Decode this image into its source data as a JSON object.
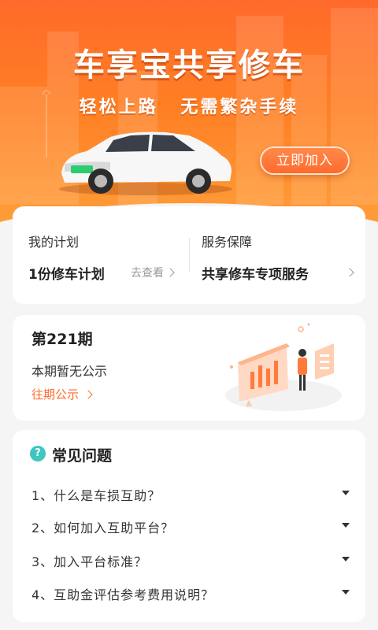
{
  "banner": {
    "headline": "车享宝共享修车",
    "subline": "轻松上路 无需繁杂手续",
    "join_button": "立即加入",
    "accent_color": "#ff6a2e"
  },
  "plan": {
    "left_title": "我的计划",
    "left_value": "1份修车计划",
    "left_link": "去查看",
    "right_title": "服务保障",
    "right_value": "共享修车专项服务"
  },
  "period": {
    "title": "第221期",
    "status": "本期暂无公示",
    "link": "往期公示"
  },
  "faq": {
    "icon": "?",
    "title": "常见问题",
    "items": [
      "1、什么是车损互助？",
      "2、如何加入互助平台？",
      "3、加入平台标准？",
      "4、互助金评估参考费用说明？"
    ]
  }
}
